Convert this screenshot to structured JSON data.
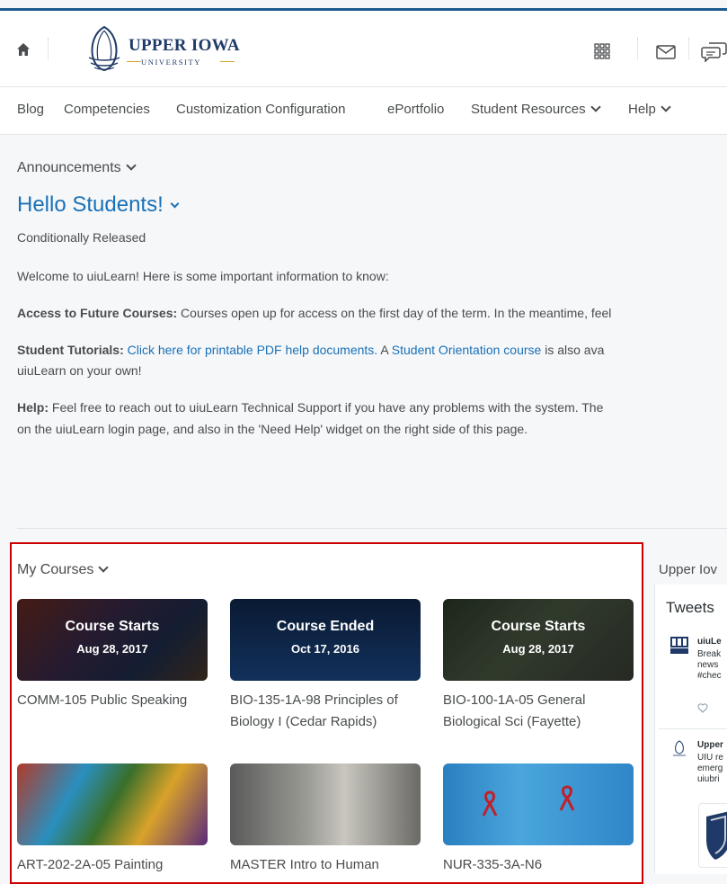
{
  "header": {
    "logo_title": "UPPER IOWA",
    "logo_subtitle": "UNIVERSITY",
    "icons": [
      "home-icon",
      "waffle-grid-icon",
      "mail-icon",
      "chat-icon"
    ]
  },
  "nav": {
    "items": [
      {
        "label": "Blog"
      },
      {
        "label": "Competencies"
      },
      {
        "label": "Customization Configuration"
      },
      {
        "label": "ePortfolio"
      },
      {
        "label": "Student Resources"
      },
      {
        "label": "Help"
      }
    ]
  },
  "announcements": {
    "heading": "Announcements",
    "title": "Hello Students!",
    "status": "Conditionally Released",
    "intro": "Welcome to uiuLearn! Here is some important information to know:",
    "p1_label": "Access to Future Courses:",
    "p1_text": " Courses open up for access on the first day of the term. In the meantime, feel",
    "p2_label": "Student Tutorials:",
    "p2_link1": "Click here for printable PDF help documents.",
    "p2_mid": " A ",
    "p2_link2": "Student Orientation course",
    "p2_tail": " is also ava",
    "p2_line2": "uiuLearn on your own!",
    "p3_label": "Help:",
    "p3_text": " Feel free to reach out to uiuLearn Technical Support if you have any problems with the system. The",
    "p3_line2": "on the uiuLearn login page, and also in the 'Need Help' widget on the right side of this page."
  },
  "courses": {
    "heading": "My Courses",
    "cards": [
      {
        "status": "Course Starts",
        "date": "Aug 28, 2017",
        "name": "COMM-105 Public Speaking"
      },
      {
        "status": "Course Ended",
        "date": "Oct 17, 2016",
        "name": "BIO-135-1A-98 Principles of Biology I (Cedar Rapids)"
      },
      {
        "status": "Course Starts",
        "date": "Aug 28, 2017",
        "name": "BIO-100-1A-05 General Biological Sci (Fayette)"
      },
      {
        "status": "",
        "date": "",
        "name": "ART-202-2A-05 Painting"
      },
      {
        "status": "",
        "date": "",
        "name": "MASTER Intro to Human"
      },
      {
        "status": "",
        "date": "",
        "name": "NUR-335-3A-N6"
      }
    ]
  },
  "sidebar": {
    "title": "Upper Iov",
    "tweets_heading": "Tweets",
    "tweet1": {
      "author": "uiuLe",
      "line1": "Break",
      "line2": "news",
      "line3": "#chec"
    },
    "tweet2": {
      "author": "Upper",
      "line1": "UIU re",
      "line2": "emerg",
      "line3": "uiubri"
    }
  },
  "colors": {
    "accent": "#1a71b8",
    "brand_navy": "#1f3a68",
    "highlight": "#cc0000"
  }
}
